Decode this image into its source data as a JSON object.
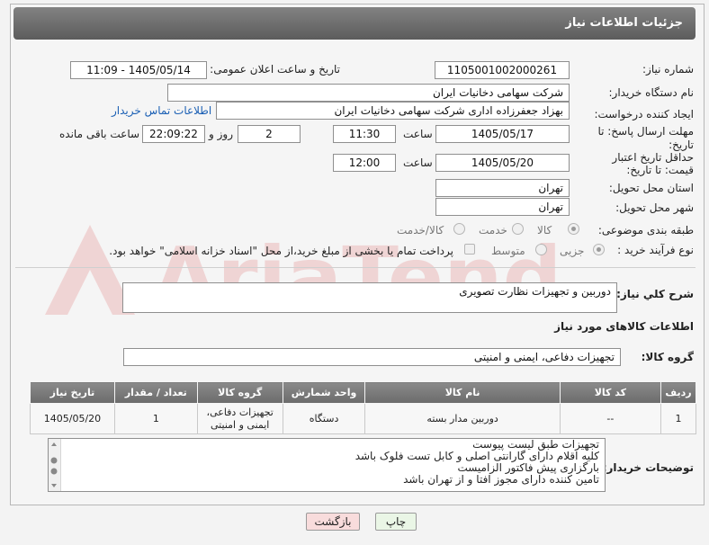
{
  "header": {
    "title": "جزئیات اطلاعات نیاز"
  },
  "fields": {
    "need_number_label": "شماره نیاز:",
    "need_number": "1105001002000261",
    "announce_label": "تاریخ و ساعت اعلان عمومی:",
    "announce_value": "1405/05/14 - 11:09",
    "buyer_org_label": "نام دستگاه خریدار:",
    "buyer_org": "شرکت سهامی دخانیات ایران",
    "requester_label": "ایجاد کننده درخواست:",
    "requester": "بهزاد جعفرزاده اداری شرکت سهامی دخانیات ایران",
    "contact_link": "اطلاعات تماس خریدار",
    "deadline_label": "مهلت ارسال پاسخ: تا تاریخ:",
    "deadline_date": "1405/05/17",
    "time_label": "ساعت",
    "deadline_time": "11:30",
    "days_value": "2",
    "days_label": "روز و",
    "remaining_time": "22:09:22",
    "remaining_label": "ساعت باقی مانده",
    "validity_label": "حداقل تاریخ اعتبار قیمت: تا تاریخ:",
    "validity_date": "1405/05/20",
    "validity_time": "12:00",
    "province_label": "استان محل تحویل:",
    "province": "تهران",
    "city_label": "شهر محل تحویل:",
    "city": "تهران",
    "category_label": "طبقه بندی موضوعی:",
    "category_options": [
      "کالا",
      "خدمت",
      "کالا/خدمت"
    ],
    "process_label": "نوع فرآیند خرید :",
    "process_options": [
      "جزیی",
      "متوسط"
    ],
    "payment_note": "پرداخت تمام یا بخشی از مبلغ خرید،از محل \"اسناد خزانه اسلامی\" خواهد بود.",
    "description_label": "شرح کلي نياز:",
    "description": "دوربین و تجهیزات نظارت تصویری",
    "goods_info_title": "اطلاعات کالاهای مورد نیاز",
    "goods_group_label": "گروه کالا:",
    "goods_group": "تجهیزات دفاعی، ایمنی و امنیتی"
  },
  "table": {
    "headers": [
      "ردیف",
      "کد کالا",
      "نام کالا",
      "واحد شمارش",
      "گروه کالا",
      "تعداد / مقدار",
      "تاریخ نیاز"
    ],
    "rows": [
      [
        "1",
        "--",
        "دوربین مدار بسته",
        "دستگاه",
        "تجهیزات دفاعی، ایمنی و امنیتی",
        "1",
        "1405/05/20"
      ]
    ]
  },
  "notes": {
    "label": "توضیحات خریدار:",
    "lines": [
      "تجهیزات طبق لیست پیوست",
      "کلیه اقلام دارای گارانتی اصلی و کابل تست فلوک باشد",
      "بارگزاری پیش فاکتور الزامیست",
      "تامین کننده دارای مجوز افتا و از تهران باشد"
    ]
  },
  "buttons": {
    "print": "چاپ",
    "back": "بازگشت"
  },
  "watermark": "AriaTender.net",
  "colors": {
    "header_bg": "#6e6e6e",
    "link": "#1a5fb4",
    "back_button": "#f8dcdc",
    "print_button": "#eaf6e6"
  }
}
